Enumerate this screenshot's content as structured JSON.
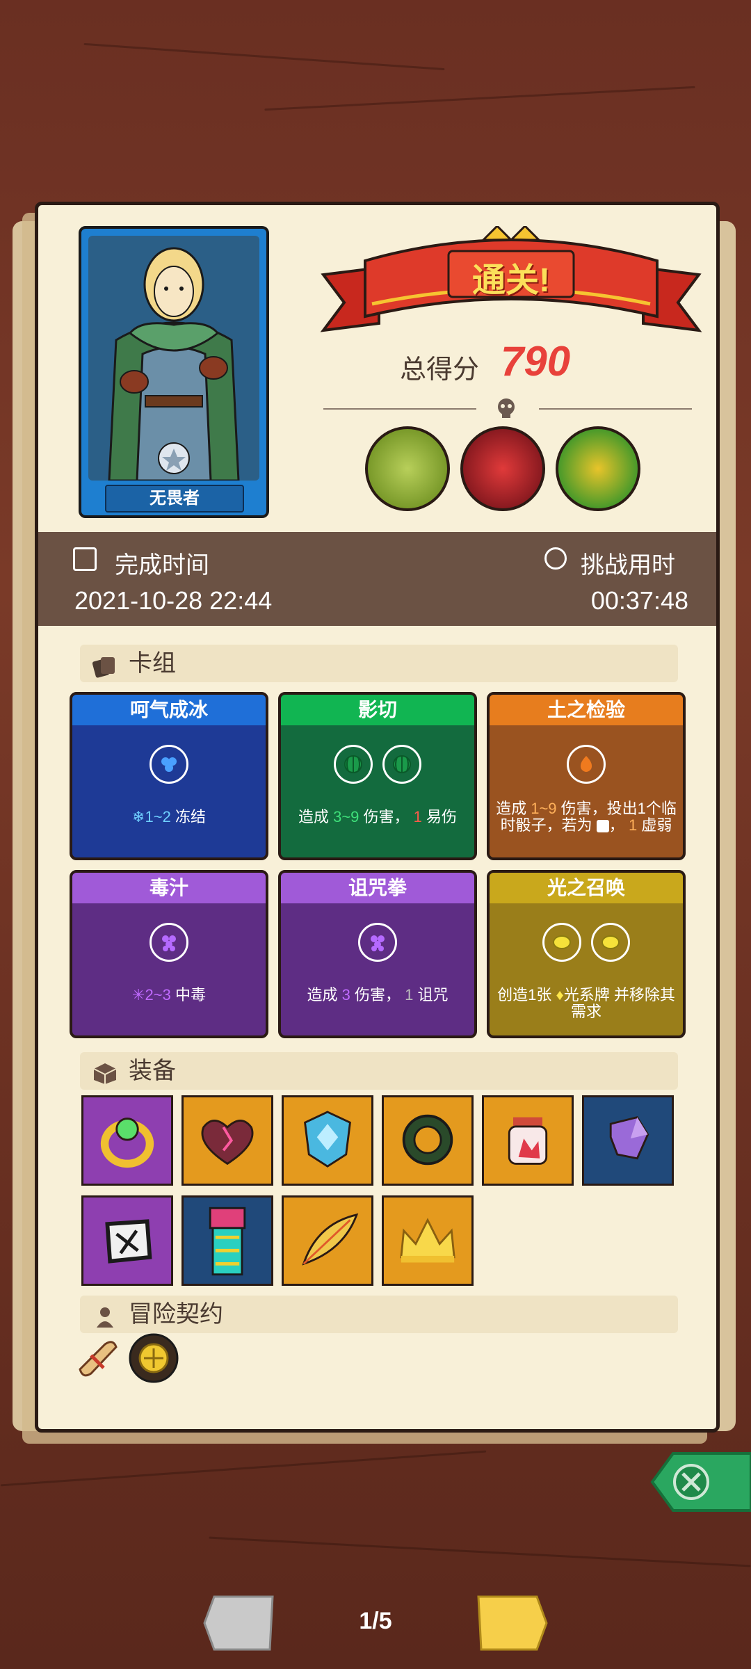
{
  "hero": {
    "name": "无畏者"
  },
  "result": {
    "title": "通关!",
    "score_label": "总得分",
    "score_value": "790"
  },
  "time": {
    "complete_label": "完成时间",
    "complete_value": "2021-10-28 22:44",
    "duration_label": "挑战用时",
    "duration_value": "00:37:48"
  },
  "sections": {
    "deck": "卡组",
    "equipment": "装备",
    "contract": "冒险契约"
  },
  "deck": [
    {
      "title": "呵气成冰",
      "desc_value": "1~2",
      "desc_text": "冻结",
      "color": "#1e3a96",
      "head": "#1f6fd8",
      "mana": 1,
      "mana_icon": "ice-icon"
    },
    {
      "title": "影切",
      "desc_pre": "造成",
      "desc_value": "3~9",
      "desc_mid": "伤害，",
      "desc_value2": "1",
      "desc_text": "易伤",
      "color": "#136b3e",
      "head": "#11b552",
      "mana": 2,
      "mana_icon": "melon-icon"
    },
    {
      "title": "土之检验",
      "desc_pre": "造成",
      "desc_value": "1~9",
      "desc_text": "伤害，投出1个临时骰子，若为",
      "desc_tail": "，",
      "desc_value2": "1",
      "desc_tail2": "虚弱",
      "color": "#9a5320",
      "head": "#e77d1e",
      "mana": 1,
      "mana_icon": "fire-icon"
    },
    {
      "title": "毒汁",
      "desc_value": "2~3",
      "desc_text": "中毒",
      "color": "#5e2d84",
      "head": "#a05ad8",
      "mana": 1,
      "mana_icon": "grape-icon"
    },
    {
      "title": "诅咒拳",
      "desc_pre": "造成",
      "desc_value": "3",
      "desc_mid": "伤害，",
      "desc_value2": "1",
      "desc_text": "诅咒",
      "color": "#5e2d84",
      "head": "#a05ad8",
      "mana": 1,
      "mana_icon": "grape-icon"
    },
    {
      "title": "光之召唤",
      "desc_text": "创造1张",
      "desc_mid": "光系牌 并移除其需求",
      "color": "#9a7e1a",
      "head": "#c9a81c",
      "mana": 2,
      "mana_icon": "lemon-icon"
    }
  ],
  "equipment": [
    {
      "icon": "ring-icon",
      "bg": "#8e3fb0"
    },
    {
      "icon": "cracked-heart-icon",
      "bg": "#e49a1e"
    },
    {
      "icon": "shield-gem-icon",
      "bg": "#e49a1e"
    },
    {
      "icon": "horn-icon",
      "bg": "#e49a1e"
    },
    {
      "icon": "jar-icon",
      "bg": "#e49a1e"
    },
    {
      "icon": "crystal-icon",
      "bg": "#20497a"
    },
    {
      "icon": "rune-stone-icon",
      "bg": "#8e3fb0"
    },
    {
      "icon": "totem-icon",
      "bg": "#20497a"
    },
    {
      "icon": "feather-icon",
      "bg": "#e49a1e"
    },
    {
      "icon": "crown-icon",
      "bg": "#e49a1e"
    }
  ],
  "contracts": [
    {
      "icon": "scroll-icon"
    },
    {
      "icon": "lemon-coin-icon"
    }
  ],
  "pagination": {
    "indicator": "1/5"
  }
}
